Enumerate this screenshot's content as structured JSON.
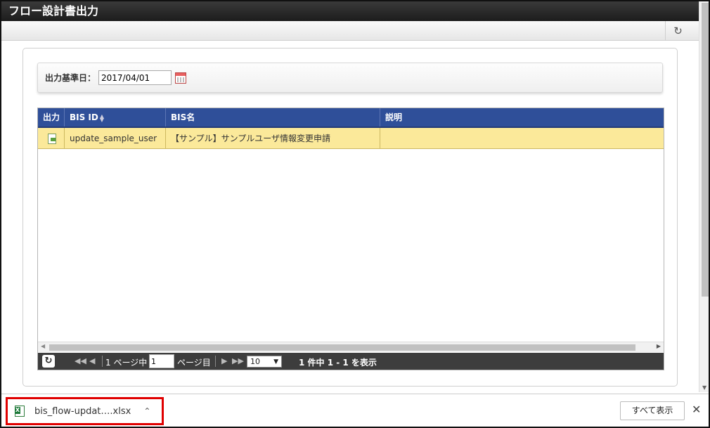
{
  "window": {
    "title": "フロー設計書出力"
  },
  "toolbar": {
    "refresh_icon": "refresh-icon"
  },
  "criteria": {
    "label": "出力基準日：",
    "date_value": "2017/04/01"
  },
  "grid": {
    "headers": [
      "出力",
      "BIS ID",
      "BIS名",
      "説明"
    ],
    "rows": [
      {
        "bis_id": "update_sample_user",
        "bis_name": "【サンプル】サンプルユーザ情報変更申請",
        "description": ""
      }
    ]
  },
  "pager": {
    "page_prefix": "1 ページ中",
    "page_value": "1",
    "page_suffix": "ページ目",
    "page_size": "10",
    "summary": "1 件中 1 - 1 を表示"
  },
  "downloads": {
    "file_name": "bis_flow-updat….xlsx",
    "show_all": "すべて表示"
  }
}
